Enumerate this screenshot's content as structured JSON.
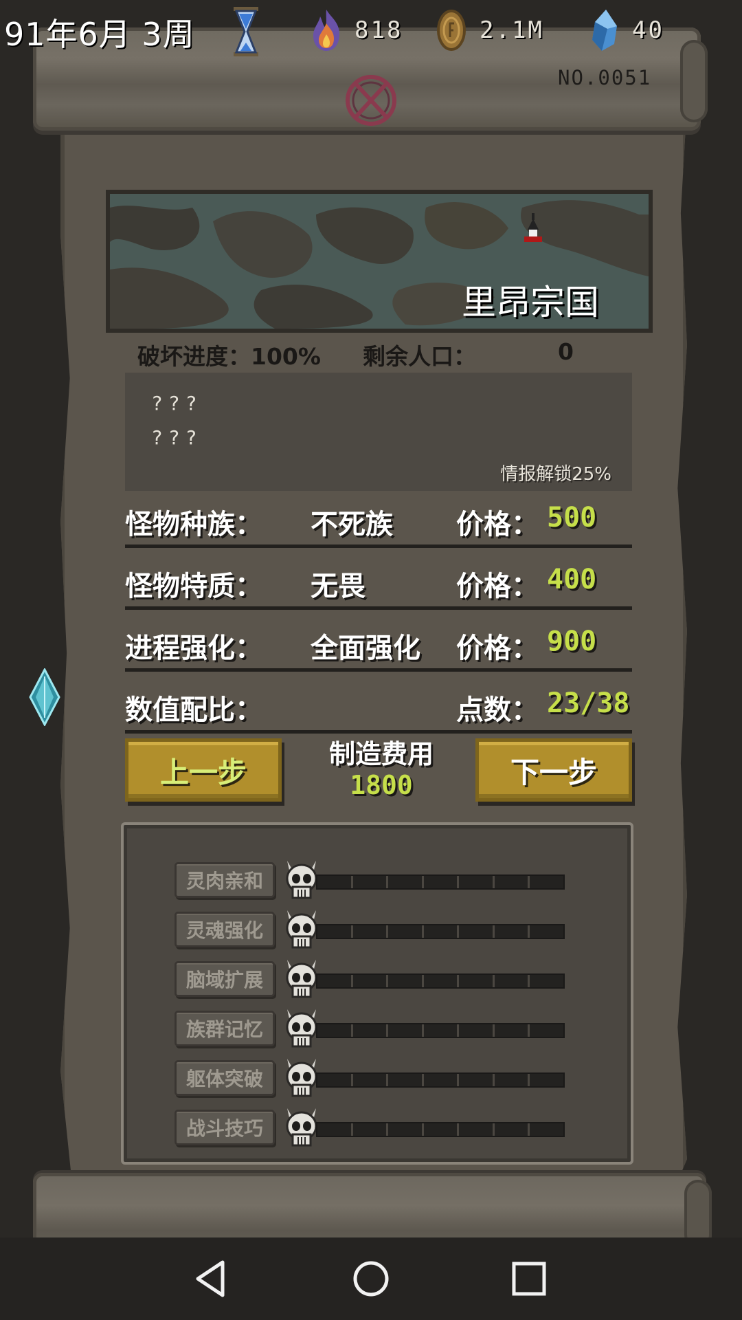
{
  "status": {
    "date": "91年6月 3周",
    "resources": [
      {
        "icon": "flame-icon",
        "value": "818"
      },
      {
        "icon": "coin-icon",
        "value": "2.1M"
      },
      {
        "icon": "crystal-icon",
        "value": "40"
      }
    ]
  },
  "scroll": {
    "number": "NO.0051",
    "country_name": "里昂宗国",
    "destruction_label": "破坏进度：100%",
    "population_label": "剩余人口：",
    "population_value": "0"
  },
  "intel": {
    "line1": "???",
    "line2": "???",
    "unlock": "情报解锁25%"
  },
  "attributes": [
    {
      "label": "怪物种族：",
      "value": "不死族",
      "price_label": "价格：",
      "price": "500"
    },
    {
      "label": "怪物特质：",
      "value": "无畏",
      "price_label": "价格：",
      "price": "400"
    },
    {
      "label": "进程强化：",
      "value": "全面强化",
      "price_label": "价格：",
      "price": "900"
    },
    {
      "label": "数值配比：",
      "value": "",
      "price_label": "点数：",
      "price": "23/38"
    }
  ],
  "actions": {
    "prev_label": "上一步",
    "next_label": "下一步",
    "cost_label": "制造费用",
    "cost_value": "1800"
  },
  "stats": [
    {
      "label": "灵肉亲和",
      "filled": 0,
      "segments": 7
    },
    {
      "label": "灵魂强化",
      "filled": 0,
      "segments": 7
    },
    {
      "label": "脑域扩展",
      "filled": 0,
      "segments": 7
    },
    {
      "label": "族群记忆",
      "filled": 0,
      "segments": 7
    },
    {
      "label": "躯体突破",
      "filled": 0,
      "segments": 7
    },
    {
      "label": "战斗技巧",
      "filled": 0,
      "segments": 7
    }
  ],
  "colors": {
    "accent_green": "#c6df4a",
    "button_gold": "#b18f2c",
    "parchment": "#5b554c"
  }
}
